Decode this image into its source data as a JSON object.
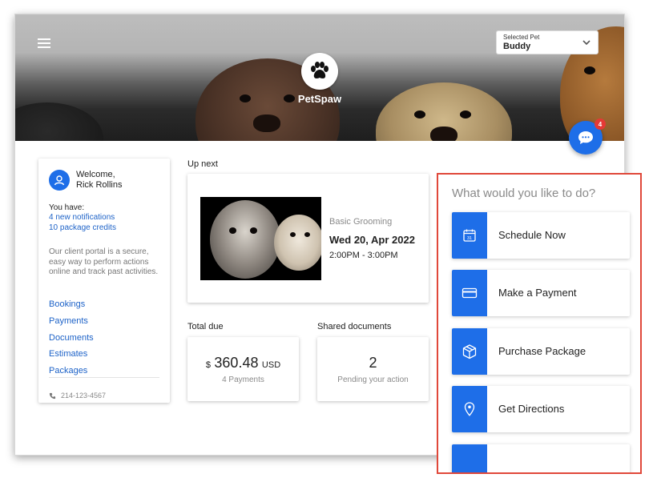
{
  "header": {
    "brand": "PetSpaw",
    "pet_select_label": "Selected Pet",
    "pet_select_value": "Buddy",
    "chat_badge_count": "4"
  },
  "sidebar": {
    "welcome_line1": "Welcome,",
    "welcome_line2": "Rick Rollins",
    "you_have": "You have:",
    "notifications": "4 new notifications",
    "credits": "10 package credits",
    "description": "Our client portal is a secure, easy way to perform actions online and track past activities.",
    "nav": [
      "Bookings",
      "Payments",
      "Documents",
      "Estimates",
      "Packages"
    ],
    "phone": "214-123-4567"
  },
  "up_next": {
    "heading": "Up next",
    "service": "Basic Grooming",
    "date": "Wed 20, Apr 2022",
    "time": "2:00PM - 3:00PM"
  },
  "total_due": {
    "heading": "Total due",
    "currency": "$",
    "amount": "360.48",
    "unit": "USD",
    "payments": "4 Payments"
  },
  "shared_docs": {
    "heading": "Shared documents",
    "count": "2",
    "status": "Pending your action"
  },
  "actions": {
    "title": "What would you like to do?",
    "items": [
      {
        "label": "Schedule Now",
        "icon": "calendar-icon"
      },
      {
        "label": "Make a Payment",
        "icon": "credit-card-icon"
      },
      {
        "label": "Purchase Package",
        "icon": "package-box-icon"
      },
      {
        "label": "Get Directions",
        "icon": "location-pin-icon"
      },
      {
        "label": "",
        "icon": "unknown-icon"
      }
    ]
  },
  "colors": {
    "accent": "#1e6ee8",
    "link": "#1e63c8",
    "highlight_border": "#e0483a",
    "badge": "#e53935"
  }
}
